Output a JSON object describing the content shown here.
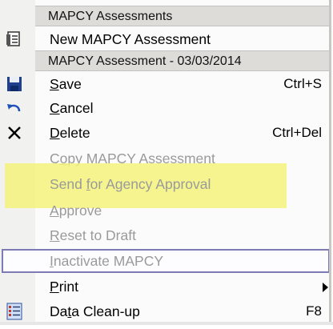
{
  "menu": {
    "section1_header": "MAPCY Assessments",
    "new_assessment": "New MAPCY Assessment",
    "section2_header": "MAPCY Assessment - 03/03/2014",
    "save": {
      "pre": "",
      "mn": "S",
      "post": "ave",
      "shortcut": "Ctrl+S"
    },
    "cancel": {
      "pre": "",
      "mn": "C",
      "post": "ancel"
    },
    "delete": {
      "pre": "",
      "mn": "D",
      "post": "elete",
      "shortcut": "Ctrl+Del"
    },
    "copy": {
      "pre": "C",
      "mn": "o",
      "post": "py MAPCY Assessment"
    },
    "send": {
      "pre": "Send ",
      "mn": "f",
      "post": "or Agency Approval"
    },
    "approve": {
      "pre": "",
      "mn": "A",
      "post": "pprove"
    },
    "reset": {
      "pre": "",
      "mn": "R",
      "post": "eset to Draft"
    },
    "inactivate": {
      "pre": "",
      "mn": "I",
      "post": "nactivate MAPCY"
    },
    "print": {
      "pre": "",
      "mn": "P",
      "post": "rint"
    },
    "cleanup": {
      "pre": "Da",
      "mn": "t",
      "post": "a Clean-up",
      "shortcut": "F8"
    }
  },
  "colors": {
    "highlight": "#f3f27a",
    "header_bg": "#dedcd8",
    "disabled_text": "#9a9a9a",
    "hover_border": "#7e7ab4"
  },
  "icons": [
    "document-icon",
    "save-floppy-icon",
    "undo-arrow-icon",
    "delete-x-icon",
    "cleanup-list-icon",
    "submenu-arrow-icon"
  ]
}
